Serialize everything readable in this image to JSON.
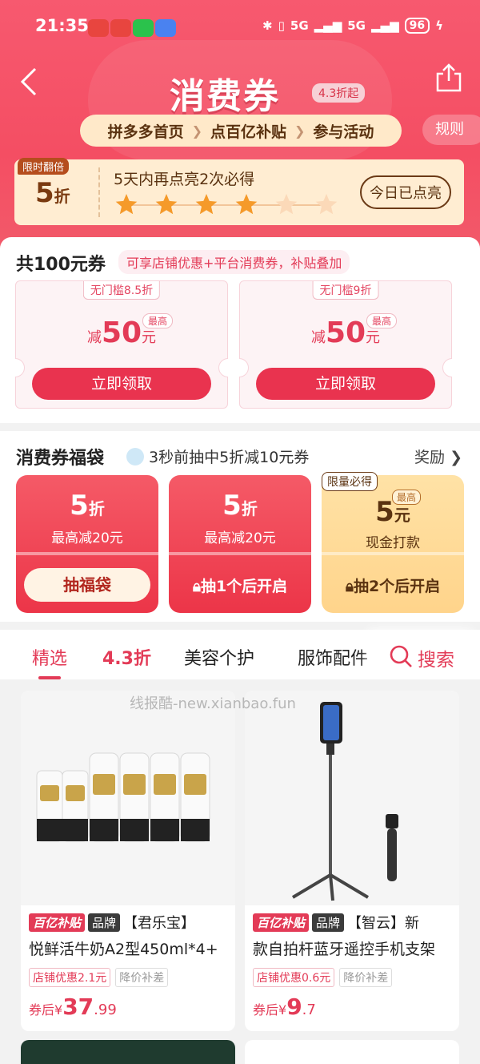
{
  "status_bar": {
    "time": "21:35",
    "network": "5G",
    "battery": "96"
  },
  "header": {
    "title": "消费券",
    "title_badge": "4.3折起",
    "steps": [
      "拼多多首页",
      "点百亿补贴",
      "参与活动"
    ],
    "rules": "规则"
  },
  "bonus": {
    "tag": "限时翻倍",
    "discount_num": "5",
    "discount_unit": "折",
    "message": "5天内再点亮2次必得",
    "stars_total": 6,
    "stars_lit": 4,
    "today": "今日已点亮"
  },
  "coupons": {
    "heading": "共100元券",
    "note": "可享店铺优惠+平台消费券，补贴叠加",
    "items": [
      {
        "label": "无门槛8.5折",
        "prefix": "减",
        "amount": "50",
        "unit": "元",
        "max": "最高",
        "button": "立即领取"
      },
      {
        "label": "无门槛9折",
        "prefix": "减",
        "amount": "50",
        "unit": "元",
        "max": "最高",
        "button": "立即领取"
      }
    ]
  },
  "lucky_bag": {
    "heading": "消费券福袋",
    "live": "3秒前抽中5折减10元券",
    "reward": "奖励",
    "bags": [
      {
        "num": "5",
        "unit": "折",
        "sub": "最高减20元",
        "action": "抽福袋"
      },
      {
        "num": "5",
        "unit": "折",
        "sub": "最高减20元",
        "action": "抽1个后开启"
      },
      {
        "quota": "限量必得",
        "max": "最高",
        "num": "5",
        "unit": "元",
        "sub": "现金打款",
        "action": "抽2个后开启"
      }
    ]
  },
  "tabs": [
    "精选",
    "4.3折",
    "美容个护",
    "服饰配件"
  ],
  "search_label": "搜索",
  "watermark": "线报酷-new.xianbao.fun",
  "products": [
    {
      "badge": "百亿补贴",
      "brand_tag": "品牌",
      "brand": "【君乐宝】",
      "name": "悦鲜活牛奶A2型450ml*4+",
      "chips": [
        "店铺优惠2.1元",
        "降价补差"
      ],
      "price_prefix": "券后¥",
      "price_int": "37",
      "price_dec": ".99"
    },
    {
      "badge": "百亿补贴",
      "brand_tag": "品牌",
      "brand": "【智云】新",
      "name": "款自拍杆蓝牙遥控手机支架",
      "chips": [
        "店铺优惠0.6元",
        "降价补差"
      ],
      "price_prefix": "券后¥",
      "price_int": "9",
      "price_dec": ".7"
    }
  ],
  "colors": {
    "accent": "#e33b57",
    "banner": "#f44e63",
    "gold": "#ffedd2"
  }
}
